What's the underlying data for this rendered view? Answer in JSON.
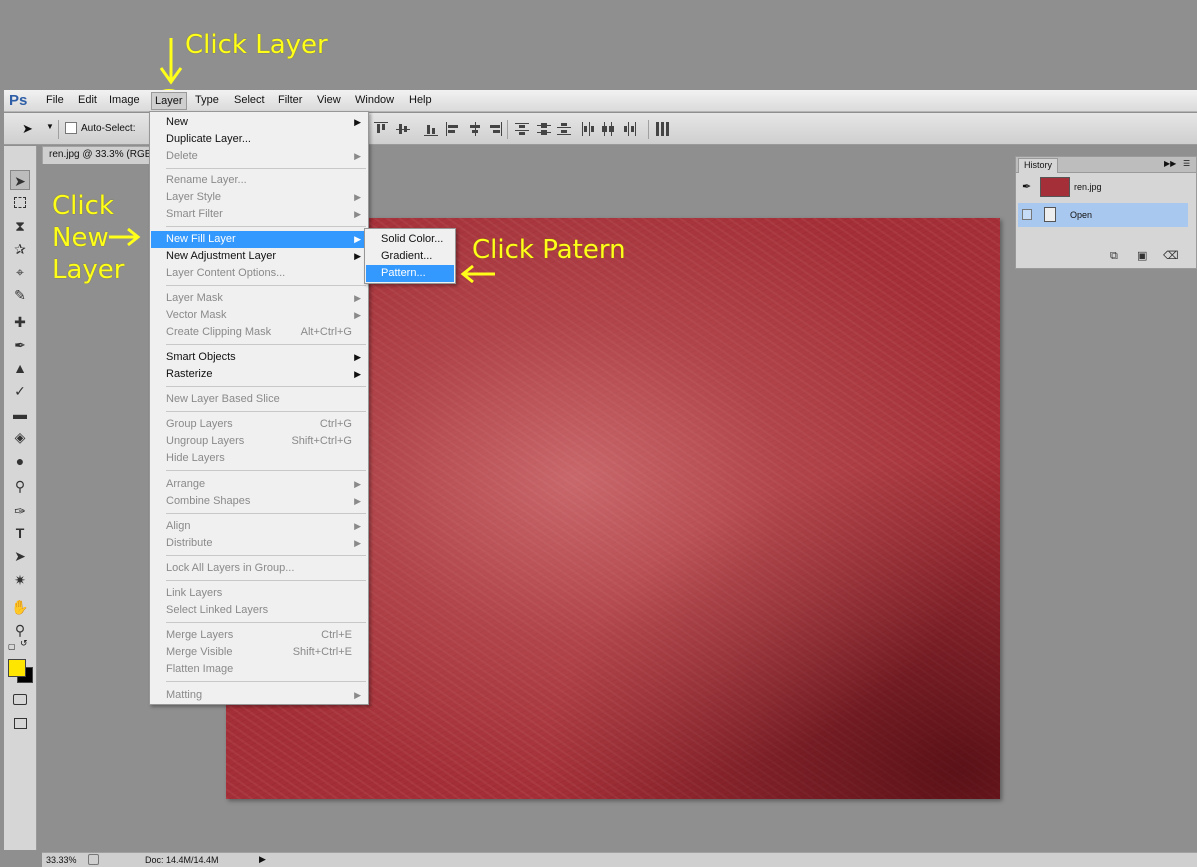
{
  "annotations": {
    "click_layer": "Click Layer",
    "click_new_layer_1": "Click",
    "click_new_layer_2": "New",
    "click_new_layer_3": "Layer",
    "click_pattern": "Click Patern",
    "color": "#ffff1a"
  },
  "app": {
    "logo": "Ps",
    "brand_color": "#2e5ea6"
  },
  "menubar": {
    "items": [
      "File",
      "Edit",
      "Image",
      "Layer",
      "Type",
      "Select",
      "Filter",
      "View",
      "Window",
      "Help"
    ],
    "active": "Layer"
  },
  "optionsbar": {
    "auto_select_label": "Auto-Select:"
  },
  "document": {
    "tab_title": "ren.jpg @ 33.3% (RGB"
  },
  "layer_menu": {
    "new": "New",
    "duplicate_layer": "Duplicate Layer...",
    "delete": "Delete",
    "rename_layer": "Rename Layer...",
    "layer_style": "Layer Style",
    "smart_filter": "Smart Filter",
    "new_fill_layer": "New Fill Layer",
    "new_adjustment_layer": "New Adjustment Layer",
    "layer_content_options": "Layer Content Options...",
    "layer_mask": "Layer Mask",
    "vector_mask": "Vector Mask",
    "create_clipping_mask": "Create Clipping Mask",
    "create_clipping_mask_sc": "Alt+Ctrl+G",
    "smart_objects": "Smart Objects",
    "rasterize": "Rasterize",
    "new_layer_based_slice": "New Layer Based Slice",
    "group_layers": "Group Layers",
    "group_layers_sc": "Ctrl+G",
    "ungroup_layers": "Ungroup Layers",
    "ungroup_layers_sc": "Shift+Ctrl+G",
    "hide_layers": "Hide Layers",
    "arrange": "Arrange",
    "combine_shapes": "Combine Shapes",
    "align": "Align",
    "distribute": "Distribute",
    "lock_all_layers": "Lock All Layers in Group...",
    "link_layers": "Link Layers",
    "select_linked_layers": "Select Linked Layers",
    "merge_layers": "Merge Layers",
    "merge_layers_sc": "Ctrl+E",
    "merge_visible": "Merge Visible",
    "merge_visible_sc": "Shift+Ctrl+E",
    "flatten_image": "Flatten Image",
    "matting": "Matting",
    "highlight_color": "#3399ff"
  },
  "fill_submenu": {
    "solid_color": "Solid Color...",
    "gradient": "Gradient...",
    "pattern": "Pattern..."
  },
  "history": {
    "title": "History",
    "snapshot_name": "ren.jpg",
    "state_open": "Open"
  },
  "statusbar": {
    "zoom": "33.33%",
    "doc_info": "Doc: 14.4M/14.4M"
  },
  "colors": {
    "foreground": "#ffe600",
    "background": "#000000",
    "canvas_texture": "#a52f38"
  }
}
